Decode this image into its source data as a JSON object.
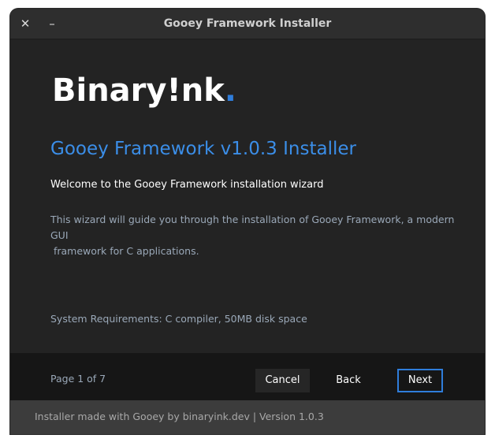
{
  "window": {
    "title": "Gooey Framework Installer",
    "close_glyph": "✕",
    "minimize_glyph": "–"
  },
  "logo": {
    "text": "Binary!nk",
    "dot": "."
  },
  "main": {
    "heading": "Gooey Framework v1.0.3 Installer",
    "welcome": "Welcome to the Gooey Framework installation wizard",
    "description_line1": "This wizard will guide you through the installation of Gooey Framework, a modern GUI",
    "description_line2": " framework for C applications.",
    "requirements": "System Requirements: C compiler, 50MB disk space"
  },
  "footer": {
    "page_indicator": "Page 1 of 7",
    "cancel_label": "Cancel",
    "back_label": "Back",
    "next_label": "Next"
  },
  "statusbar": {
    "text": "Installer made with Gooey by binaryink.dev | Version 1.0.3"
  },
  "colors": {
    "accent": "#3b8ee8",
    "background": "#232323",
    "footer_bg": "#161616",
    "statusbar_bg": "#3c3c3c"
  }
}
